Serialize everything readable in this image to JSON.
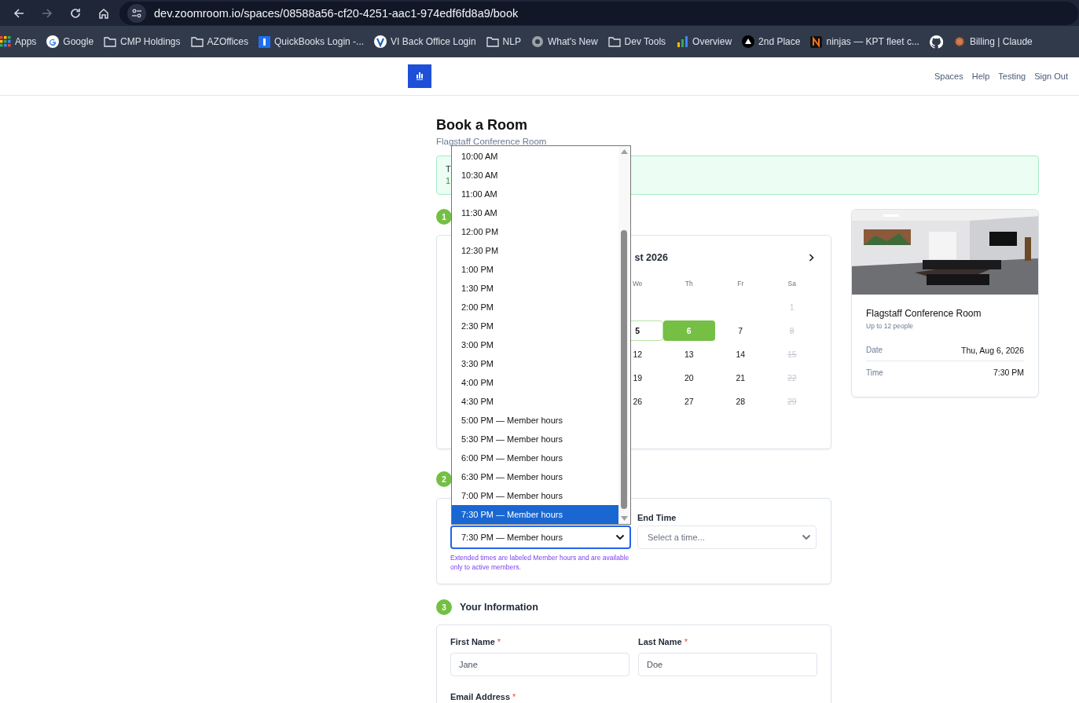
{
  "browser": {
    "url": "dev.zoomroom.io/spaces/08588a56-cf20-4251-aac1-974edf6fd8a9/book",
    "bookmarks": [
      {
        "kind": "labeled",
        "label": "Apps"
      },
      {
        "kind": "labeled",
        "label": "Google"
      },
      {
        "kind": "labeled",
        "label": "CMP Holdings"
      },
      {
        "kind": "labeled",
        "label": "AZOffices"
      },
      {
        "kind": "labeled",
        "label": "QuickBooks Login -..."
      },
      {
        "kind": "labeled",
        "label": "VI Back Office Login"
      },
      {
        "kind": "labeled",
        "label": "NLP"
      },
      {
        "kind": "labeled",
        "label": "What's New"
      },
      {
        "kind": "labeled",
        "label": "Dev Tools"
      },
      {
        "kind": "labeled",
        "label": "Overview"
      },
      {
        "kind": "labeled",
        "label": "2nd Place"
      },
      {
        "kind": "labeled",
        "label": "ninjas — KPT fleet c..."
      },
      {
        "kind": "icon"
      },
      {
        "kind": "labeled",
        "label": "Billing | Claude"
      }
    ]
  },
  "header": {
    "nav": [
      "Spaces",
      "Help",
      "Testing",
      "Sign Out"
    ]
  },
  "page": {
    "title": "Book a Room",
    "subtitle": "Flagstaff Conference Room"
  },
  "notice": {
    "lines": [
      "T",
      "1"
    ]
  },
  "calendar": {
    "step": "1",
    "month_title": "st 2026",
    "weekdays": [
      "We",
      "Th",
      "Fr",
      "Sa"
    ],
    "weeks": [
      [
        {
          "day": "1",
          "kind": "muted"
        }
      ],
      [
        {
          "day": "5",
          "kind": "today"
        },
        {
          "day": "6",
          "kind": "selected"
        },
        {
          "day": "7",
          "kind": "normal"
        },
        {
          "day": "8",
          "kind": "blocked"
        }
      ],
      [
        {
          "day": "12",
          "kind": "normal"
        },
        {
          "day": "13",
          "kind": "normal"
        },
        {
          "day": "14",
          "kind": "normal"
        },
        {
          "day": "15",
          "kind": "blocked"
        }
      ],
      [
        {
          "day": "19",
          "kind": "normal"
        },
        {
          "day": "20",
          "kind": "normal"
        },
        {
          "day": "21",
          "kind": "normal"
        },
        {
          "day": "22",
          "kind": "blocked"
        }
      ],
      [
        {
          "day": "26",
          "kind": "normal"
        },
        {
          "day": "27",
          "kind": "normal"
        },
        {
          "day": "28",
          "kind": "normal"
        },
        {
          "day": "29",
          "kind": "blocked"
        }
      ]
    ]
  },
  "time": {
    "step": "2",
    "start_value": "7:30 PM — Member hours",
    "end_label": "End Time",
    "end_placeholder": "Select a time...",
    "hint": "Extended times are labeled Member hours and are available only to active members.",
    "options": [
      {
        "label": "10:00 AM",
        "selected": false
      },
      {
        "label": "10:30 AM",
        "selected": false
      },
      {
        "label": "11:00 AM",
        "selected": false
      },
      {
        "label": "11:30 AM",
        "selected": false
      },
      {
        "label": "12:00 PM",
        "selected": false
      },
      {
        "label": "12:30 PM",
        "selected": false
      },
      {
        "label": "1:00 PM",
        "selected": false
      },
      {
        "label": "1:30 PM",
        "selected": false
      },
      {
        "label": "2:00 PM",
        "selected": false
      },
      {
        "label": "2:30 PM",
        "selected": false
      },
      {
        "label": "3:00 PM",
        "selected": false
      },
      {
        "label": "3:30 PM",
        "selected": false
      },
      {
        "label": "4:00 PM",
        "selected": false
      },
      {
        "label": "4:30 PM",
        "selected": false
      },
      {
        "label": "5:00 PM — Member hours",
        "selected": false
      },
      {
        "label": "5:30 PM — Member hours",
        "selected": false
      },
      {
        "label": "6:00 PM — Member hours",
        "selected": false
      },
      {
        "label": "6:30 PM — Member hours",
        "selected": false
      },
      {
        "label": "7:00 PM — Member hours",
        "selected": false
      },
      {
        "label": "7:30 PM — Member hours",
        "selected": true
      }
    ]
  },
  "info": {
    "step": "3",
    "title": "Your Information",
    "fields": [
      {
        "label": "First Name",
        "required_mark": "*",
        "placeholder": "Jane"
      },
      {
        "label": "Last Name",
        "required_mark": "*",
        "placeholder": "Doe"
      }
    ],
    "email": {
      "label": "Email Address",
      "required_mark": "*"
    }
  },
  "summary": {
    "name": "Flagstaff Conference Room",
    "capacity": "Up to 12 people",
    "rows": [
      {
        "label": "Date",
        "value": "Thu, Aug 6, 2026"
      },
      {
        "label": "Time",
        "value": "7:30 PM"
      }
    ]
  }
}
